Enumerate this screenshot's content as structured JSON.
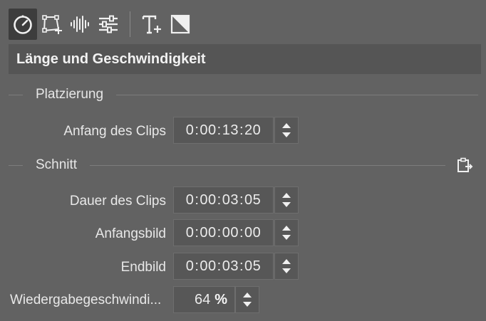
{
  "toolbar": {
    "tools": [
      {
        "icon": "speedometer-icon",
        "active": true
      },
      {
        "icon": "transform-icon",
        "active": false
      },
      {
        "icon": "audio-waveform-icon",
        "active": false
      },
      {
        "icon": "sliders-icon",
        "active": false
      },
      {
        "icon": "text-add-icon",
        "active": false
      },
      {
        "icon": "mask-icon",
        "active": false
      }
    ]
  },
  "section": {
    "title": "Länge und Geschwindigkeit"
  },
  "placement": {
    "title": "Platzierung",
    "clip_start": {
      "label": "Anfang des Clips",
      "value": [
        "0",
        "00",
        "13",
        "20"
      ]
    }
  },
  "cut": {
    "title": "Schnitt",
    "paste_icon": "paste-icon",
    "clip_duration": {
      "label": "Dauer des Clips",
      "value": [
        "0",
        "00",
        "03",
        "05"
      ]
    },
    "start_frame": {
      "label": "Anfangsbild",
      "value": [
        "0",
        "00",
        "00",
        "00"
      ]
    },
    "end_frame": {
      "label": "Endbild",
      "value": [
        "0",
        "00",
        "03",
        "05"
      ]
    }
  },
  "playback_speed": {
    "label": "Wiedergabegeschwindi...",
    "value": "64",
    "unit": "%"
  },
  "colors": {
    "background": "#626262",
    "header_bg": "#555555",
    "field_bg": "#575757",
    "active_tool_bg": "#3d3d3d"
  }
}
